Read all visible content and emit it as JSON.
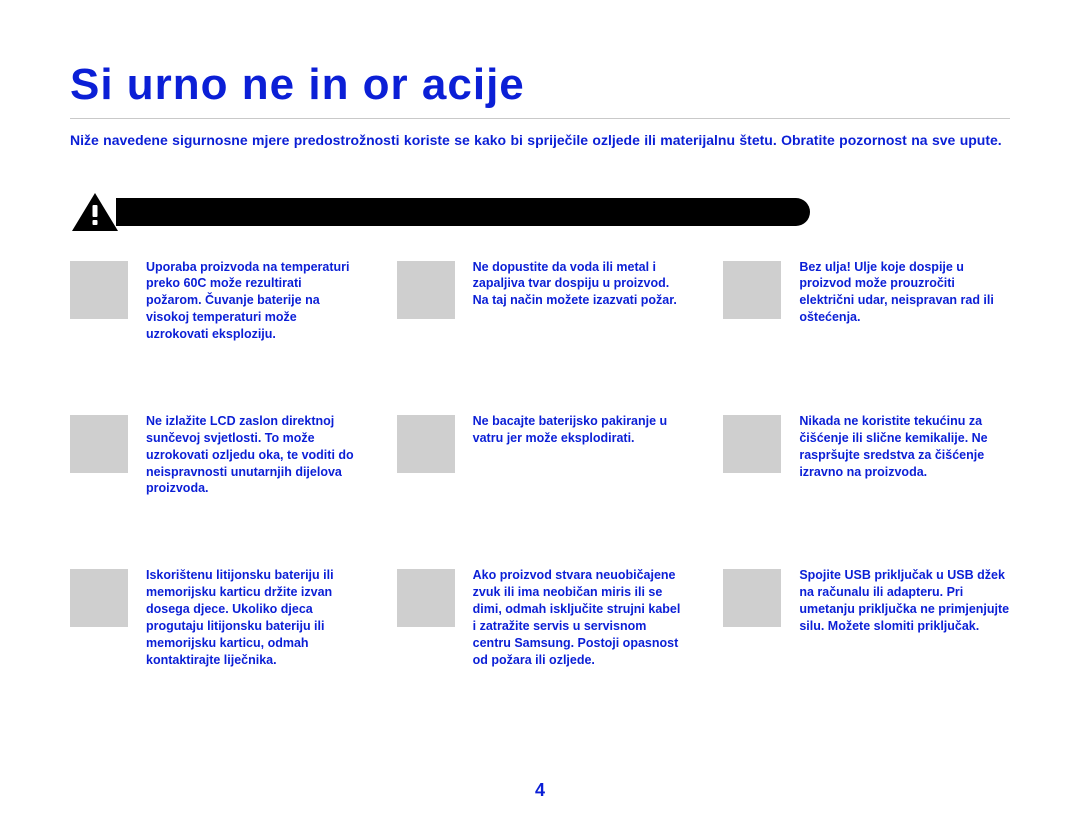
{
  "title": "Si urno ne in or acije",
  "intro": "Niže navedene sigurnosne mjere predostrožnosti koriste se kako bi spriječile ozljede ili materijalnu štetu. Obratite pozornost na sve upute.",
  "page_number": "4",
  "items": {
    "r1c1": "Uporaba proizvoda na temperaturi preko 60C može rezultirati požarom. Čuvanje baterije na visokoj temperaturi može uzrokovati eksploziju.",
    "r1c2": "Ne dopustite da voda ili metal i zapaljiva tvar dospiju u proizvod. Na taj način možete izazvati požar.",
    "r1c3": "Bez ulja! Ulje koje dospije u proizvod može prouzročiti električni udar, neispravan rad ili oštećenja.",
    "r2c1": "Ne izlažite LCD zaslon direktnoj sunčevoj svjetlosti. To može uzrokovati ozljedu oka, te voditi do neispravnosti unutarnjih dijelova proizvoda.",
    "r2c2": "Ne bacajte baterijsko pakiranje u vatru jer može eksplodirati.",
    "r2c3": "Nikada ne koristite tekućinu za čišćenje ili slične kemikalije. Ne raspršujte sredstva za čišćenje izravno na proizvoda.",
    "r3c1": "Iskorištenu litijonsku bateriju ili memorijsku karticu držite izvan dosega djece. Ukoliko djeca progutaju litijonsku bateriju ili memorijsku karticu, odmah kontaktirajte liječnika.",
    "r3c2": "Ako proizvod stvara neuobičajene zvuk ili ima neobičan miris ili se dimi, odmah isključite strujni kabel i zatražite servis u servisnom centru Samsung. Postoji opasnost od požara ili ozljede.",
    "r3c3": "Spojite USB priključak u USB džek na računalu ili adapteru. Pri umetanju priključka ne primjenjujte silu. Možete slomiti priključak."
  }
}
